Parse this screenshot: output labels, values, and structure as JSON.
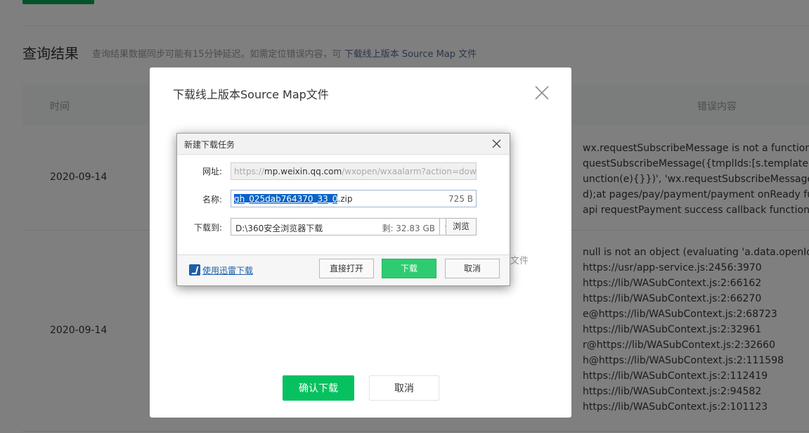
{
  "background": {
    "section_title": "查询结果",
    "section_desc": "查询结果数据同步可能有15分钟延迟。如需定位错误内容，可",
    "section_link": "下载线上版本 Source Map 文件",
    "table_headers": {
      "time": "时间",
      "error": "错误内容"
    },
    "rows": [
      {
        "date": "2020-09-14",
        "error_lines": [
          "wx.requestSubscribeMessage is not a function. (",
          "questSubscribeMessage({tmplIds:[s.templateId],",
          "unction(e){}})', 'wx.requestSubscribeMessage' is",
          "d);at pages/pay/payment/payment onReady fun",
          "api requestPayment success callback function"
        ]
      },
      {
        "date": "2020-09-14",
        "error_lines": [
          "null is not an object (evaluating 'a.data.openId')",
          "https://usr/app-service.js:2456:3970",
          "https://lib/WASubContext.js:2:66162",
          "https://lib/WASubContext.js:2:66270",
          "e@https://lib/WASubContext.js:2:68723",
          "https://lib/WASubContext.js:2:32961",
          "r@https://lib/WASubContext.js:2:32660",
          "h@https://lib/WASubContext.js:2:111598",
          "https://lib/WASubContext.js:2:112419",
          "https://lib/WASubContext.js:2:94582",
          "https://lib/WASubContext.js:2:101123"
        ]
      }
    ]
  },
  "dialog": {
    "title": "下载线上版本Source Map文件",
    "partial_text": "文件",
    "confirm_label": "确认下载",
    "cancel_label": "取消"
  },
  "download_dialog": {
    "title": "新建下载任务",
    "url_label": "网址:",
    "url_prefix": "https://",
    "url_domain": "mp.weixin.qq.com",
    "url_rest": "/wxopen/wxaalarm?action=downl",
    "name_label": "名称:",
    "name_selected": "gh_025dab764370_33_0",
    "name_ext": ".zip",
    "file_size": "725 B",
    "save_label": "下载到:",
    "save_path": "D:\\360安全浏览器下载",
    "free_space": "剩: 32.83 GB",
    "browse_label": "浏览",
    "thunder_link": "使用迅雷下载",
    "open_label": "直接打开",
    "download_label": "下载",
    "cancel_label": "取消"
  },
  "colors": {
    "brand_green": "#07c160",
    "download_green": "#2ecc71",
    "link_blue": "#576b95",
    "selection_blue": "#0a64c8"
  },
  "icons": [
    "close-icon",
    "thunder-icon",
    "chevron-down-icon"
  ]
}
